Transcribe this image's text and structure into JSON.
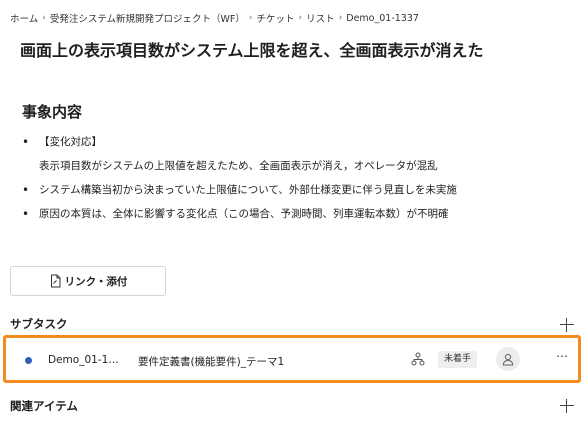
{
  "breadcrumb": {
    "items": [
      "ホーム",
      "受発注システム新規開発プロジェクト（WF）",
      "チケット",
      "リスト",
      "Demo_01-1337"
    ],
    "separator": "›"
  },
  "page_title": "画面上の表示項目数がシステム上限を超え、全画面表示が消えた",
  "incident": {
    "heading": "事象内容",
    "bullet_1": "【変化対応】",
    "bullet_1_detail": "表示項目数がシステムの上限値を超えたため、全画面表示が消え，オペレータが混乱",
    "bullet_2": "システム構築当初から決まっていた上限値について、外部仕様変更に伴う見直しを未実施",
    "bullet_3": "原因の本質は、全体に影響する変化点（この場合、予測時間、列車運転本数）が不明確"
  },
  "link_attach_label": "リンク・添付",
  "subtasks": {
    "heading": "サブタスク",
    "items": [
      {
        "id": "Demo_01-1…",
        "name": "要件定義書(機能要件)_テーマ1",
        "status": "未着手",
        "status_dot_color": "#2d5fb8"
      }
    ]
  },
  "related_items": {
    "heading": "関連アイテム"
  },
  "colors": {
    "highlight_border": "#f58b1f",
    "status_dot": "#2d5fb8"
  }
}
